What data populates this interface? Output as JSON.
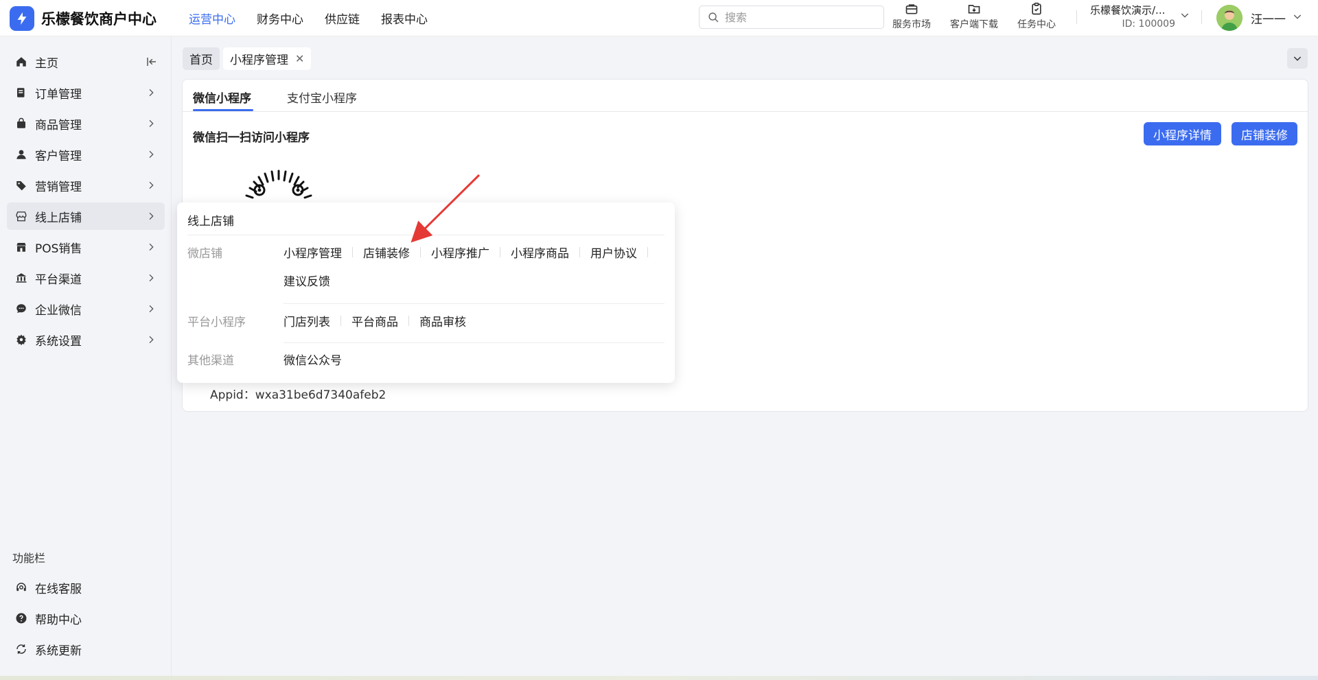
{
  "header": {
    "brand": "乐檬餐饮商户中心",
    "nav": [
      {
        "label": "运营中心",
        "active": true
      },
      {
        "label": "财务中心",
        "active": false
      },
      {
        "label": "供应链",
        "active": false
      },
      {
        "label": "报表中心",
        "active": false
      }
    ],
    "search_placeholder": "搜索",
    "tools": {
      "market": "服务市场",
      "download": "客户端下载",
      "tasks": "任务中心"
    },
    "store_name": "乐檬餐饮演示/...",
    "store_id": "ID: 100009",
    "user_name": "汪一一"
  },
  "sidebar": {
    "items": [
      {
        "label": "主页"
      },
      {
        "label": "订单管理"
      },
      {
        "label": "商品管理"
      },
      {
        "label": "客户管理"
      },
      {
        "label": "营销管理"
      },
      {
        "label": "线上店铺"
      },
      {
        "label": "POS销售"
      },
      {
        "label": "平台渠道"
      },
      {
        "label": "企业微信"
      },
      {
        "label": "系统设置"
      }
    ],
    "section_title": "功能栏",
    "bottom": [
      {
        "label": "在线客服"
      },
      {
        "label": "帮助中心"
      },
      {
        "label": "系统更新"
      }
    ]
  },
  "pagetabs": {
    "home": "首页",
    "current": "小程序管理",
    "close": "✕"
  },
  "card": {
    "tabs": [
      "微信小程序",
      "支付宝小程序"
    ],
    "title": "微信扫一扫访问小程序",
    "btn_detail": "小程序详情",
    "btn_decor": "店铺装修",
    "appid": "Appid：wxa31be6d7340afeb2"
  },
  "flyout": {
    "title": "线上店铺",
    "groups": [
      {
        "label": "微店铺",
        "links": [
          "小程序管理",
          "店铺装修",
          "小程序推广",
          "小程序商品",
          "用户协议",
          "建议反馈"
        ]
      },
      {
        "label": "平台小程序",
        "links": [
          "门店列表",
          "平台商品",
          "商品审核"
        ]
      },
      {
        "label": "其他渠道",
        "links": [
          "微信公众号"
        ]
      }
    ]
  },
  "colors": {
    "accent": "#3b6cf0",
    "annotation_arrow": "#e53935"
  },
  "icons": {
    "logo": "lightning-logo-icon",
    "search": "search-icon",
    "market": "briefcase-icon",
    "download": "folder-download-icon",
    "tasks": "clipboard-check-icon"
  }
}
